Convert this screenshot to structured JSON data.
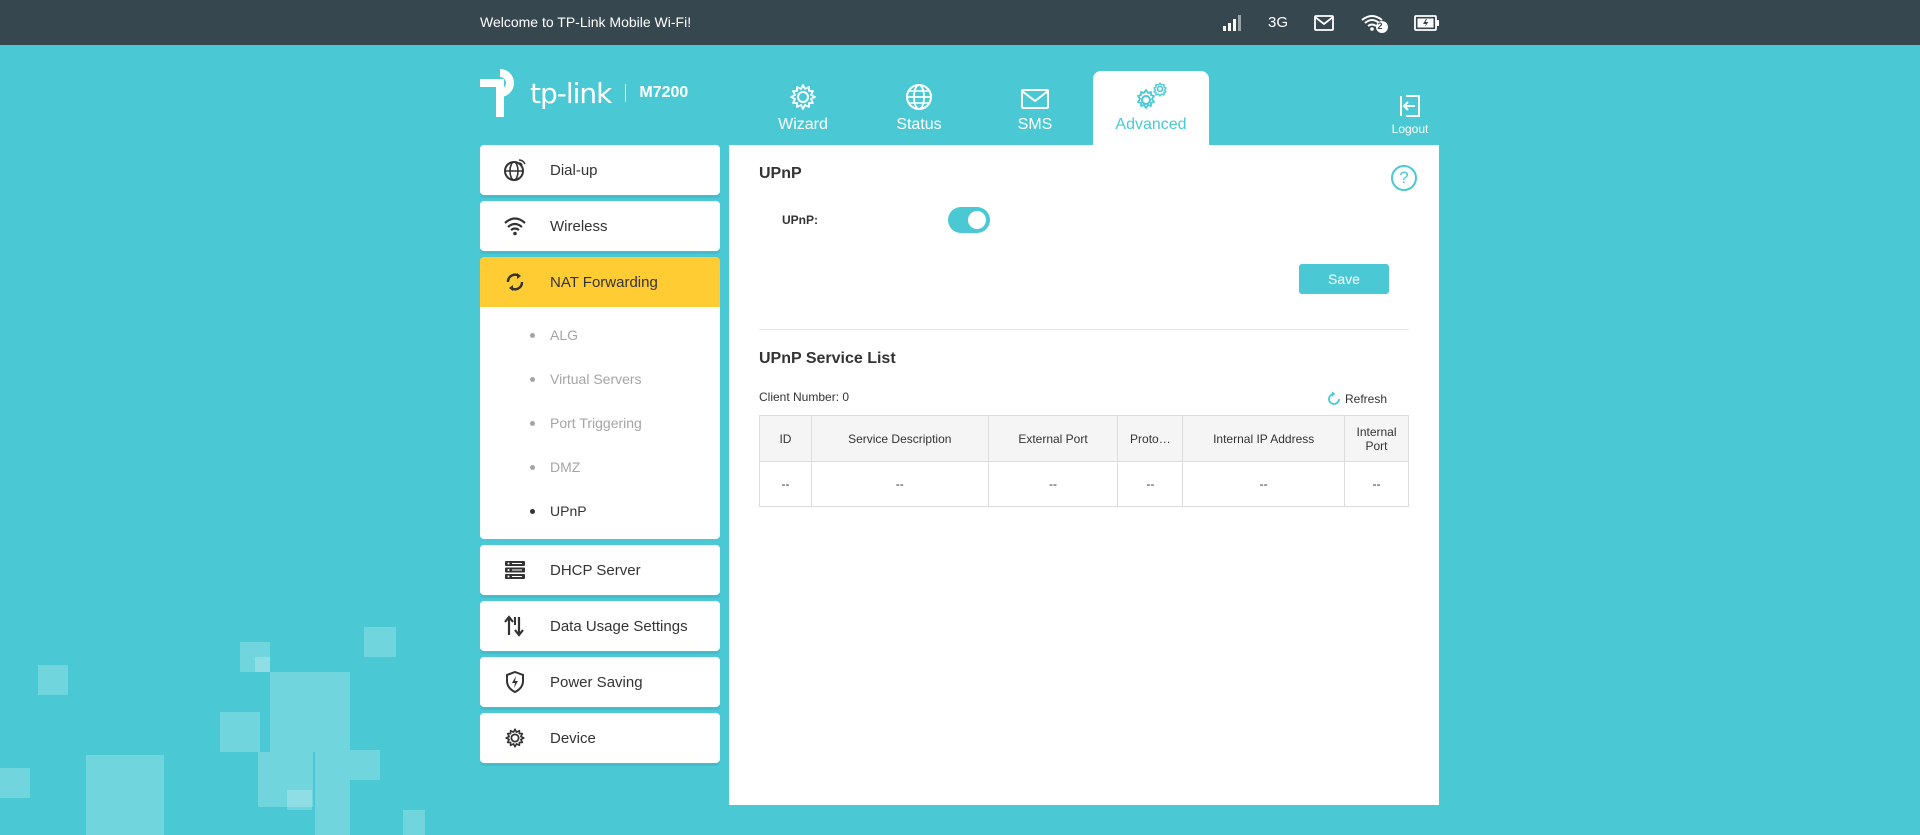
{
  "topbar": {
    "welcome": "Welcome to TP-Link Mobile Wi-Fi!",
    "network_type": "3G",
    "connected_clients": "2"
  },
  "logo": {
    "brand": "tp-link",
    "model": "M7200"
  },
  "nav": {
    "tabs": [
      {
        "label": "Wizard",
        "icon": "gear-icon"
      },
      {
        "label": "Status",
        "icon": "globe-icon"
      },
      {
        "label": "SMS",
        "icon": "envelope-icon"
      },
      {
        "label": "Advanced",
        "icon": "gears-icon",
        "active": true
      }
    ],
    "logout": "Logout"
  },
  "sidebar": {
    "items": [
      {
        "label": "Dial-up",
        "icon": "globe-dial-icon"
      },
      {
        "label": "Wireless",
        "icon": "wifi-icon"
      },
      {
        "label": "NAT Forwarding",
        "icon": "nat-icon",
        "active": true
      },
      {
        "label": "DHCP Server",
        "icon": "server-icon"
      },
      {
        "label": "Data Usage Settings",
        "icon": "data-usage-icon"
      },
      {
        "label": "Power Saving",
        "icon": "power-shield-icon"
      },
      {
        "label": "Device",
        "icon": "gear-icon"
      }
    ],
    "sub_items": [
      {
        "label": "ALG"
      },
      {
        "label": "Virtual Servers"
      },
      {
        "label": "Port Triggering"
      },
      {
        "label": "DMZ"
      },
      {
        "label": "UPnP",
        "active": true
      }
    ]
  },
  "content": {
    "upnp_title": "UPnP",
    "upnp_label": "UPnP:",
    "upnp_enabled": true,
    "save_label": "Save",
    "service_list_title": "UPnP Service List",
    "client_number": "Client Number: 0",
    "refresh_label": "Refresh",
    "table": {
      "headers": [
        "ID",
        "Service Description",
        "External Port",
        "Proto…",
        "Internal IP Address",
        "Internal Port"
      ],
      "rows": [
        [
          "--",
          "--",
          "--",
          "--",
          "--",
          "--"
        ]
      ]
    }
  },
  "colors": {
    "accent": "#4ac9d5",
    "topbar": "#37474f",
    "active_menu": "#ffcd33"
  }
}
